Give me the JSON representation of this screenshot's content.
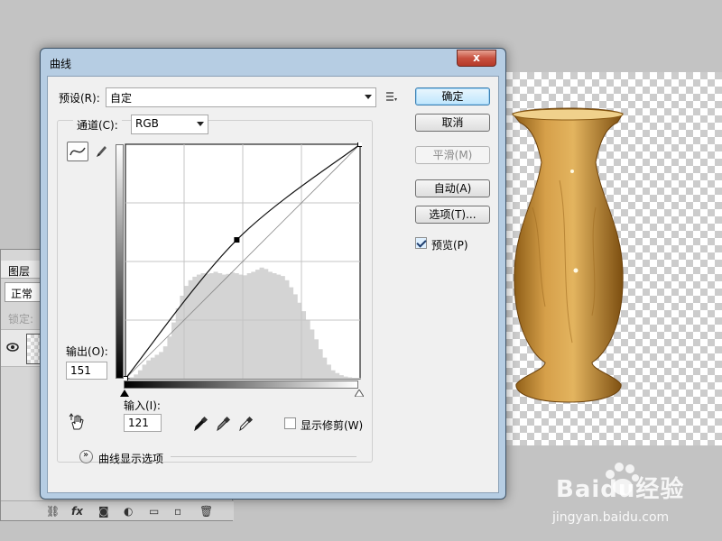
{
  "dialog": {
    "title": "曲线",
    "close_label": "x",
    "preset_label": "预设(R):",
    "preset_value": "自定",
    "channel_label": "通道(C):",
    "channel_value": "RGB",
    "output_label": "输出(O):",
    "output_value": "151",
    "input_label": "输入(I):",
    "input_value": "121",
    "show_clipping_label": "显示修剪(W)",
    "display_options_label": "曲线显示选项",
    "buttons": {
      "ok": "确定",
      "cancel": "取消",
      "smooth": "平滑(M)",
      "auto": "自动(A)",
      "options": "选项(T)..."
    },
    "preview_label": "预览(P)",
    "preview_checked": true
  },
  "layers_panel": {
    "tab_label": "图层",
    "blend_mode": "正常",
    "lock_label": "锁定:"
  },
  "watermark": {
    "brand": "Baidu经验",
    "url": "jingyan.baidu.com"
  },
  "colors": {
    "dialog_frame": "#b6cde3",
    "close_button": "#c7513f",
    "ok_button": "#bee6fd",
    "vase_body": "#c28a2c"
  },
  "chart_data": {
    "type": "line",
    "xlim": [
      0,
      255
    ],
    "ylim": [
      0,
      255
    ],
    "grid": true,
    "baseline": {
      "x": [
        0,
        255
      ],
      "y": [
        0,
        255
      ]
    },
    "curve": {
      "x": [
        0,
        121,
        255
      ],
      "y": [
        0,
        151,
        255
      ]
    },
    "control_points": [
      {
        "x": 121,
        "y": 151
      }
    ],
    "histogram": [
      0,
      2,
      6,
      12,
      20,
      26,
      30,
      34,
      38,
      46,
      60,
      80,
      100,
      118,
      132,
      140,
      145,
      148,
      150,
      149,
      150,
      152,
      150,
      148,
      149,
      151,
      150,
      148,
      147,
      150,
      152,
      155,
      158,
      156,
      152,
      150,
      148,
      146,
      140,
      130,
      120,
      108,
      96,
      84,
      70,
      56,
      42,
      30,
      20,
      12,
      8,
      5,
      3,
      2,
      1,
      1
    ]
  }
}
